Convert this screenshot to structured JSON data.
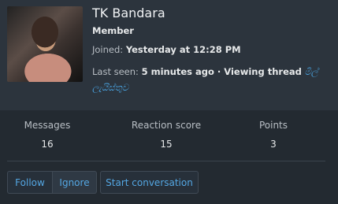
{
  "profile": {
    "name": "TK Bandara",
    "role": "Member",
    "joined_label": "Joined:",
    "joined_value": "Yesterday at 12:28 PM",
    "last_seen_label": "Last seen:",
    "last_seen_value": "5 minutes ago · Viewing thread",
    "thread_link": "මිල් ලැයිස්තුව"
  },
  "stats": [
    {
      "label": "Messages",
      "value": "16"
    },
    {
      "label": "Reaction score",
      "value": "15"
    },
    {
      "label": "Points",
      "value": "3"
    }
  ],
  "actions": {
    "follow": "Follow",
    "ignore": "Ignore",
    "conversation": "Start conversation"
  },
  "colors": {
    "accent": "#54a7e3",
    "background": "#232a31"
  }
}
